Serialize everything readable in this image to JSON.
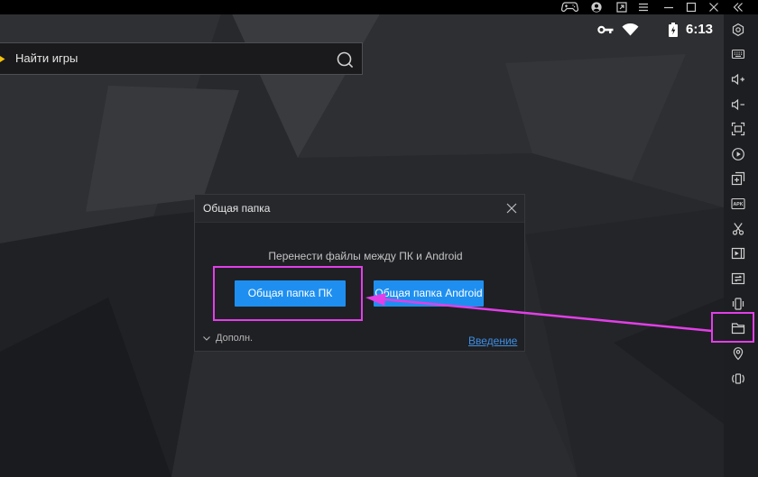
{
  "theme": {
    "accent": "#1e8ff0",
    "link": "#3d8fe3",
    "annotation": "#e23fe8",
    "search_marker": "#f4c20d"
  },
  "titlebar": {
    "icons": [
      "gamepad-icon",
      "user-icon",
      "multi-window-icon",
      "menu-icon",
      "minimize-icon",
      "maximize-icon",
      "close-icon",
      "collapse-sidebar-icon"
    ]
  },
  "status_bar": {
    "icons": [
      "vpn-key-icon",
      "wifi-icon",
      "battery-charging-icon"
    ],
    "time": "6:13"
  },
  "search": {
    "placeholder": "Найти игры",
    "icon": "search-icon"
  },
  "sidebar": {
    "items": [
      {
        "icon": "settings-icon"
      },
      {
        "icon": "keyboard-icon"
      },
      {
        "icon": "volume-up-icon"
      },
      {
        "icon": "volume-down-icon"
      },
      {
        "icon": "resize-screen-icon"
      },
      {
        "icon": "record-icon"
      },
      {
        "icon": "import-icon"
      },
      {
        "icon": "apk-icon",
        "label": "APK"
      },
      {
        "icon": "scissors-icon"
      },
      {
        "icon": "video-icon"
      },
      {
        "icon": "sync-icon"
      },
      {
        "icon": "shake-icon"
      },
      {
        "icon": "folder-icon"
      },
      {
        "icon": "location-icon"
      },
      {
        "icon": "rotate-icon"
      }
    ]
  },
  "dialog": {
    "title": "Общая папка",
    "message": "Перенести файлы между ПК и Android",
    "buttons": {
      "pc": "Общая папка ПК",
      "android": "Общая папка Android"
    },
    "more": "Дополн.",
    "help_link": "Введение"
  }
}
